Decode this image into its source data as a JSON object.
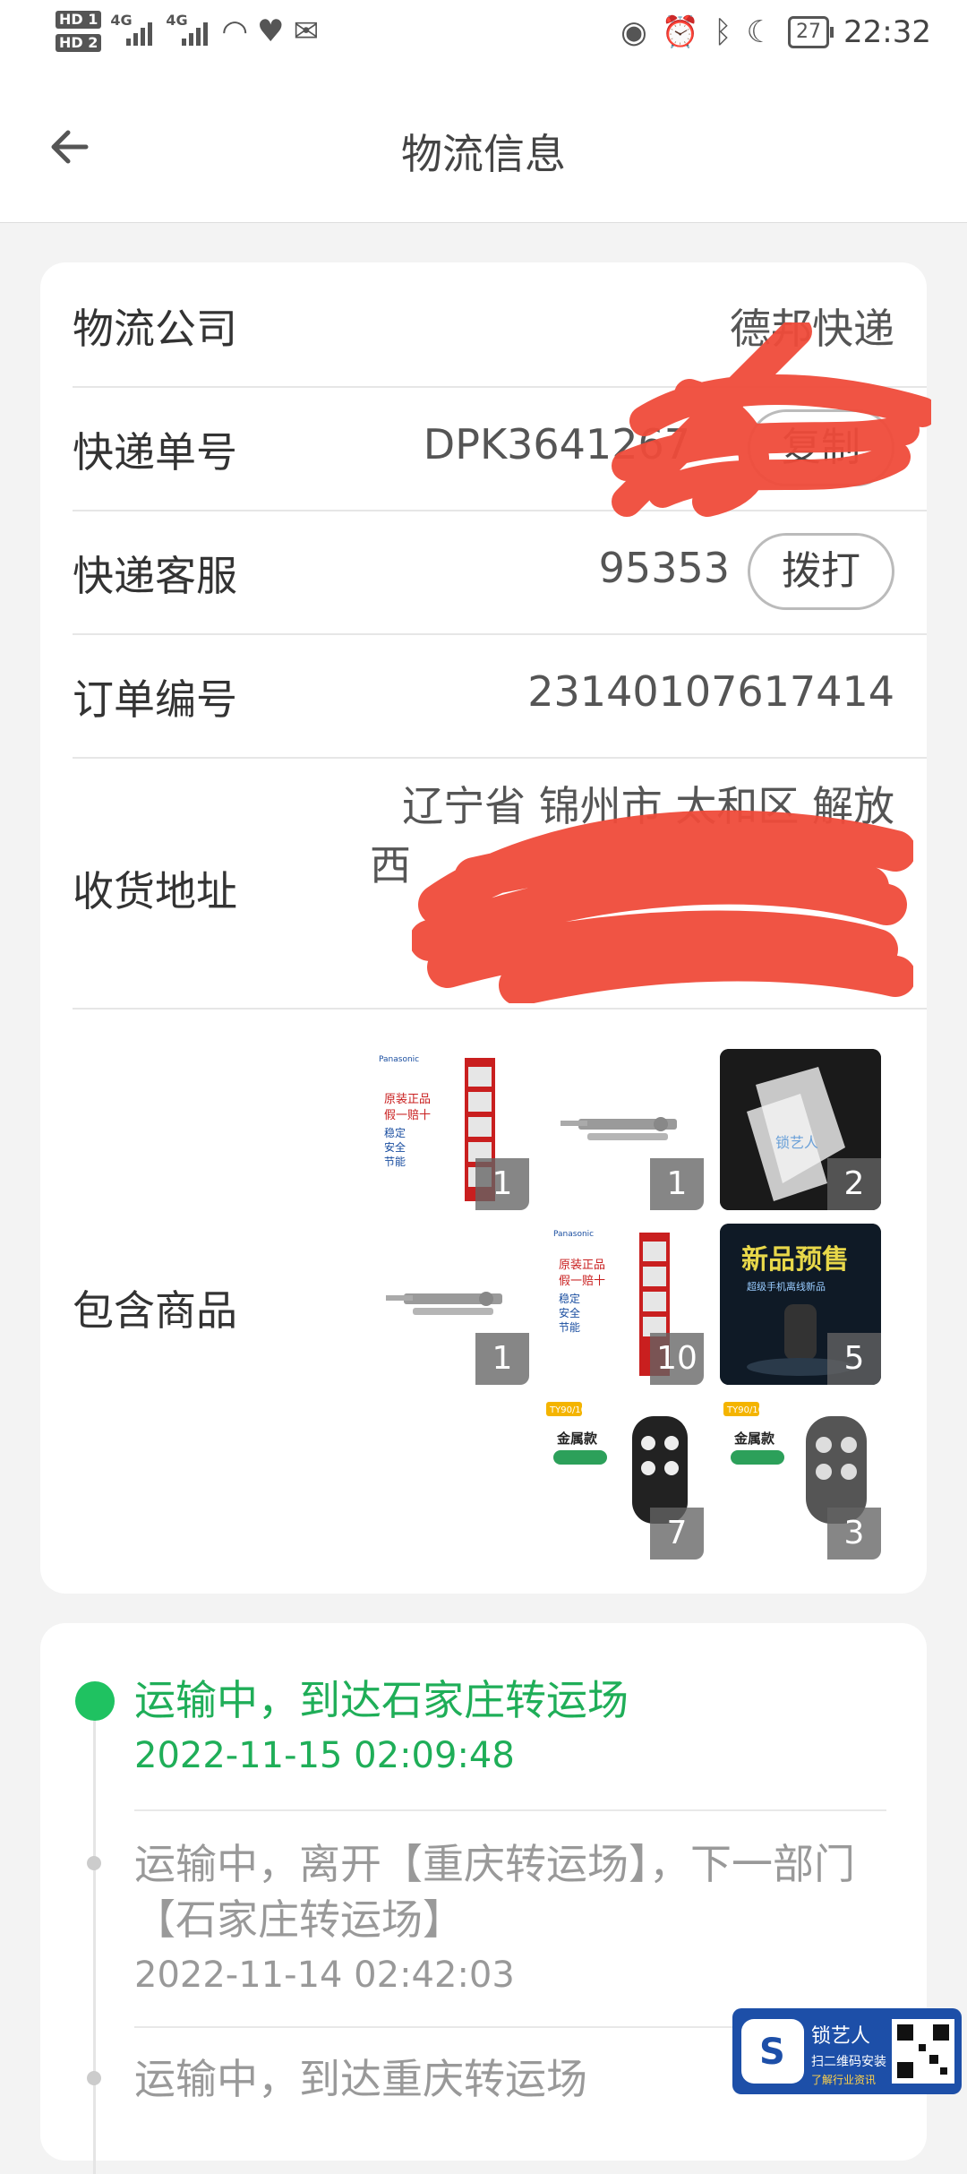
{
  "status_bar": {
    "hd1": "HD 1",
    "hd2": "HD 2",
    "net1": "4G",
    "net2": "4G",
    "battery": "27",
    "time": "22:32"
  },
  "header": {
    "title": "物流信息",
    "back_icon": "arrow-left-icon"
  },
  "info": {
    "company_label": "物流公司",
    "company_value": "德邦快递",
    "tracking_label": "快递单号",
    "tracking_value": "DPK3641267",
    "copy_button": "复制",
    "service_label": "快递客服",
    "service_value": "95353",
    "call_button": "拨打",
    "order_label": "订单编号",
    "order_value": "23140107617414",
    "address_label": "收货地址",
    "address_line1": "辽宁省 锦州市 太和区 解放",
    "address_line2": "西",
    "goods_label": "包含商品"
  },
  "goods": [
    {
      "name": "battery-card",
      "qty": "1"
    },
    {
      "name": "lock-pick-tool",
      "qty": "1"
    },
    {
      "name": "clear-film",
      "qty": "2"
    },
    {
      "name": "lock-pick-tool",
      "qty": "1"
    },
    {
      "name": "battery-card",
      "qty": "10"
    },
    {
      "name": "new-product-banner",
      "qty": "5"
    },
    {
      "name": "remote-key-slide",
      "qty": "7"
    },
    {
      "name": "remote-key-black",
      "qty": "3"
    }
  ],
  "timeline": [
    {
      "text": "运输中，到达石家庄转运场",
      "time": "2022-11-15 02:09:48"
    },
    {
      "text": "运输中，离开【重庆转运场】，下一部门【石家庄转运场】",
      "time": "2022-11-14 02:42:03"
    },
    {
      "text": "运输中，到达重庆转运场",
      "time": ""
    }
  ],
  "colors": {
    "accent_green": "#1fc261",
    "redaction": "#ef4b3a"
  }
}
